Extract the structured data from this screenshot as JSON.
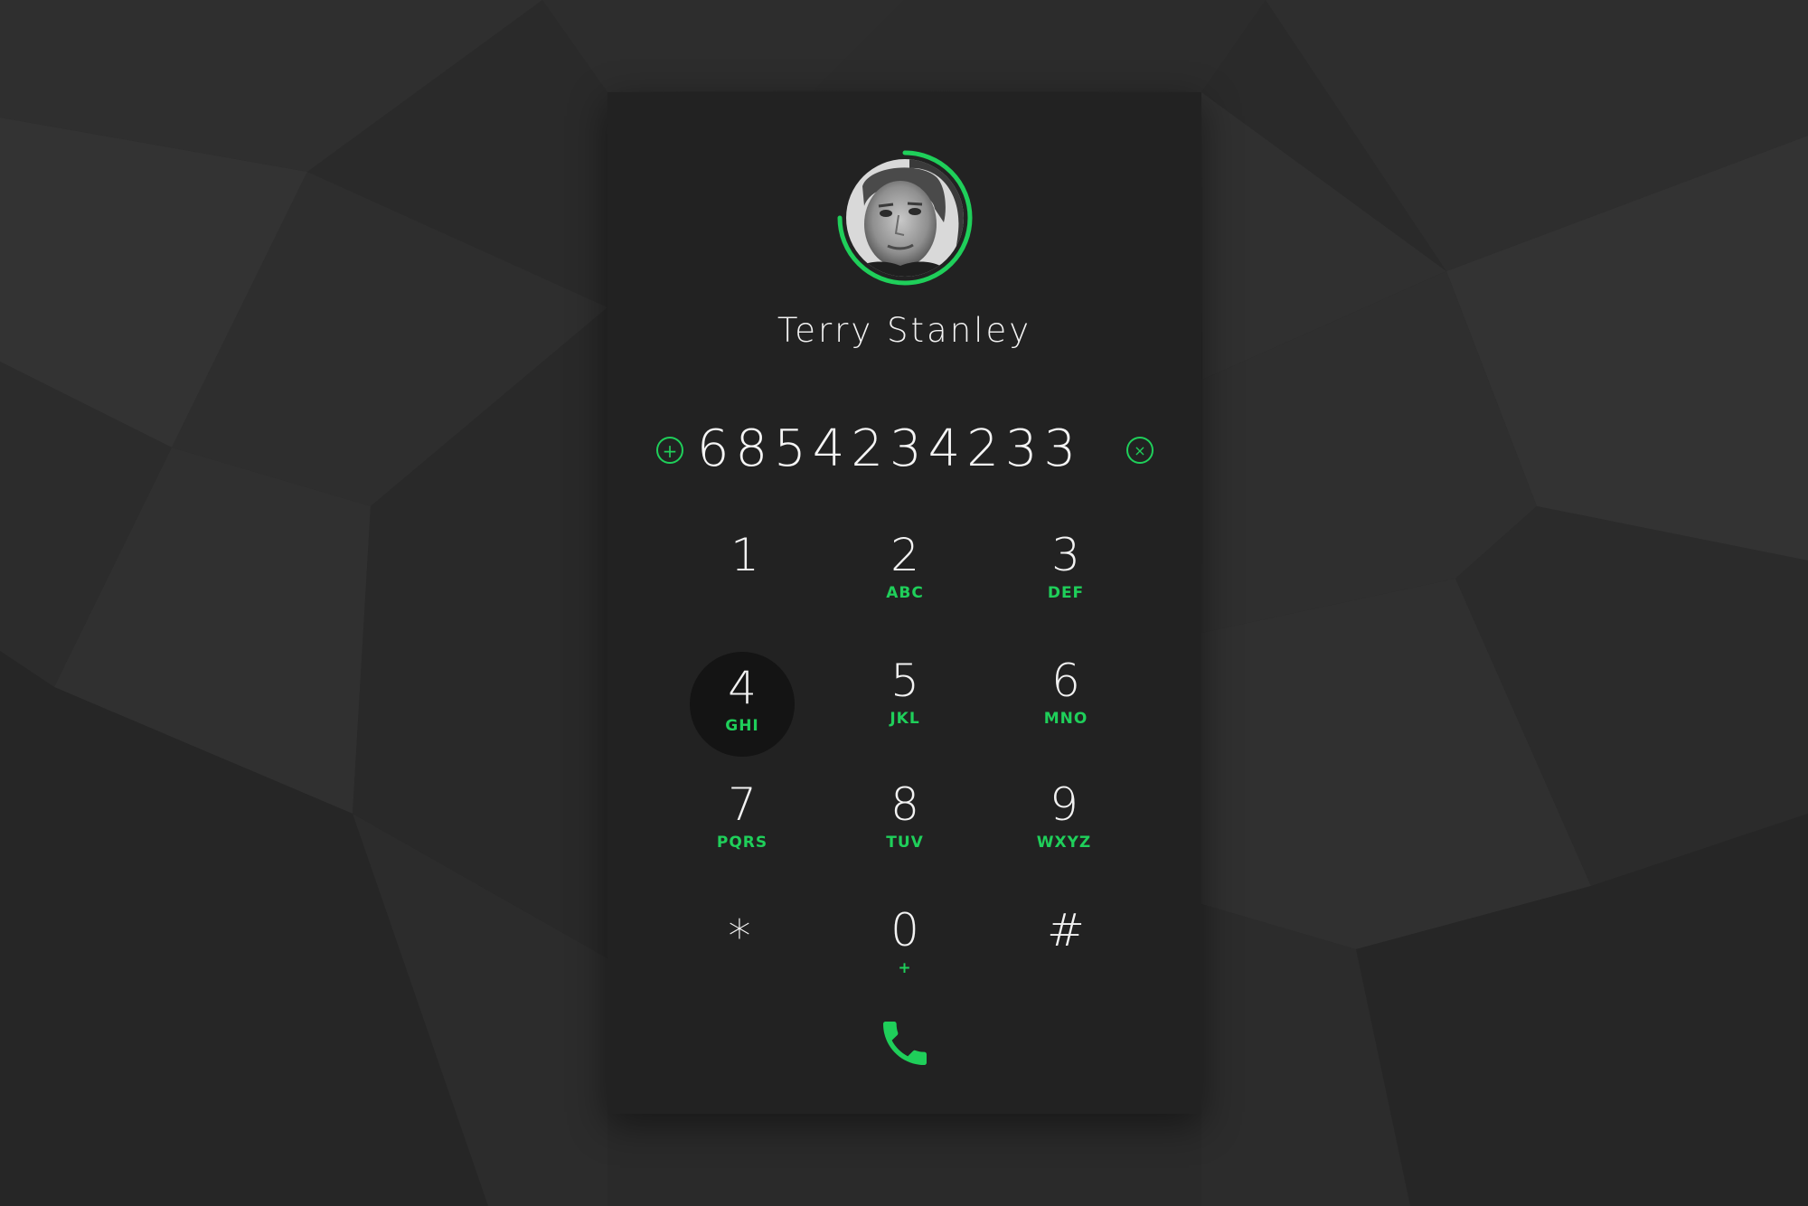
{
  "contact": {
    "name": "Terry Stanley"
  },
  "dialer": {
    "number": "6854234233",
    "add_symbol": "+",
    "clear_symbol": "×"
  },
  "keypad": {
    "keys": [
      {
        "digit": "1",
        "letters": ""
      },
      {
        "digit": "2",
        "letters": "ABC"
      },
      {
        "digit": "3",
        "letters": "DEF"
      },
      {
        "digit": "4",
        "letters": "GHI"
      },
      {
        "digit": "5",
        "letters": "JKL"
      },
      {
        "digit": "6",
        "letters": "MNO"
      },
      {
        "digit": "7",
        "letters": "PQRS"
      },
      {
        "digit": "8",
        "letters": "TUV"
      },
      {
        "digit": "9",
        "letters": "WXYZ"
      },
      {
        "digit": "*",
        "letters": ""
      },
      {
        "digit": "0",
        "letters": "+"
      },
      {
        "digit": "#",
        "letters": ""
      }
    ]
  },
  "icons": {
    "call": "phone-icon",
    "add": "plus-icon",
    "clear": "close-icon"
  },
  "colors": {
    "accent": "#1fcf5a",
    "panel": "#222222",
    "background": "#2b2b2b",
    "active_key": "#141414"
  }
}
